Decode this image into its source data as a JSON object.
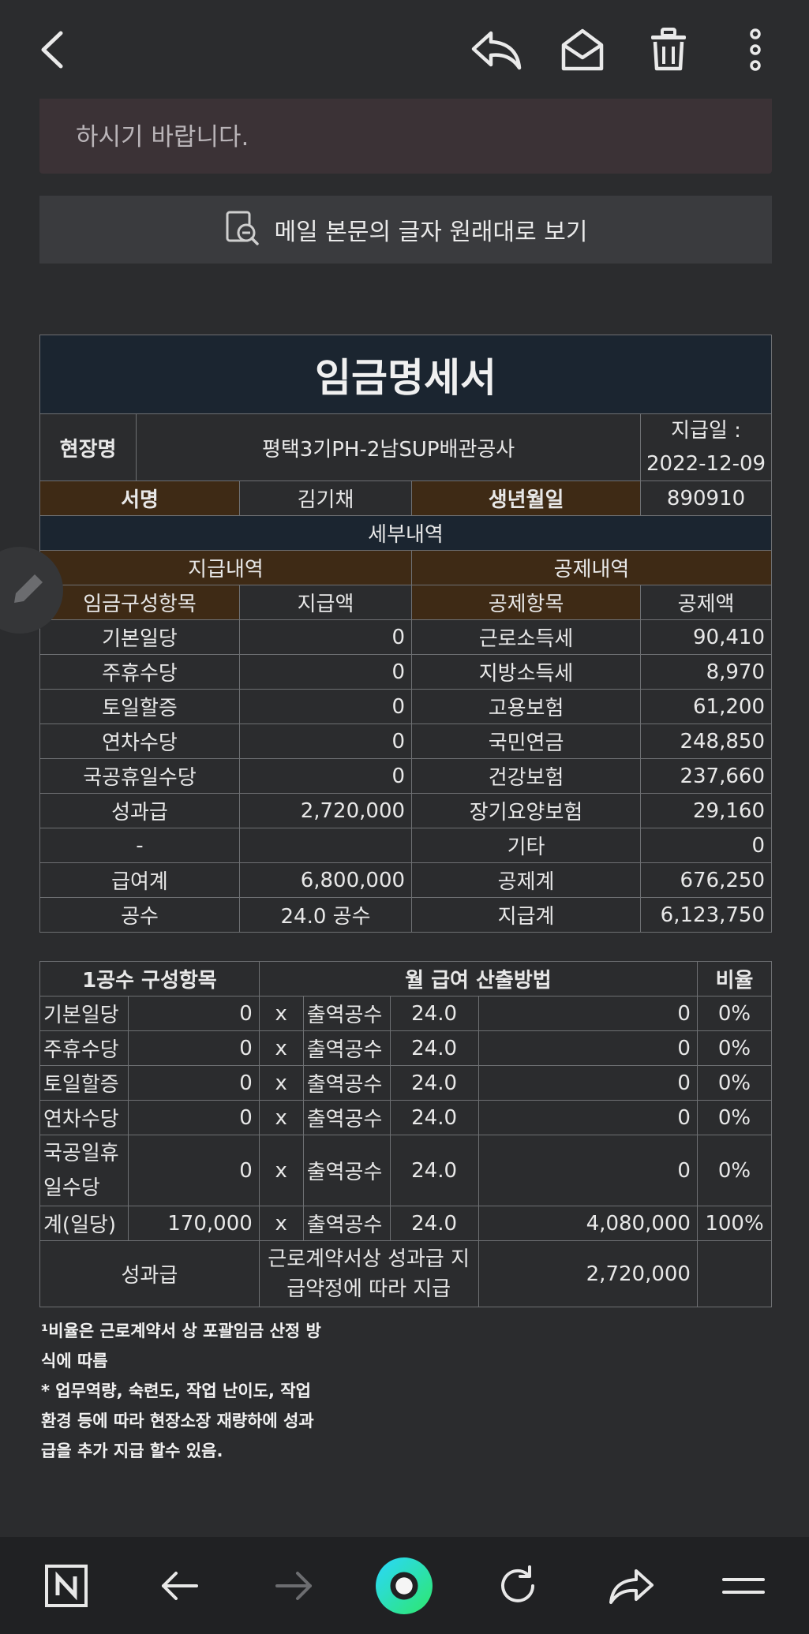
{
  "toolbar": {
    "back_icon": "back-arrow-icon",
    "reply_icon": "reply-icon",
    "unread_icon": "envelope-open-icon",
    "delete_icon": "trash-icon",
    "more_icon": "kebab-menu-icon"
  },
  "notice": {
    "text": "하시기 바랍니다."
  },
  "view_original": {
    "label": "메일 본문의 글자 원래대로 보기"
  },
  "payslip": {
    "title": "임금명세서",
    "site_label": "현장명",
    "site_value": "평택3기PH-2남SUP배관공사",
    "pay_date_label": "지급일 :",
    "pay_date_value": "2022-12-09",
    "name_label": "서명",
    "name_value": "김기채",
    "birth_label": "생년월일",
    "birth_value": "890910",
    "detail_header": "세부내역",
    "pay_section": "지급내역",
    "deduct_section": "공제내역",
    "col_pay_item": "임금구성항목",
    "col_pay_amount": "지급액",
    "col_deduct_item": "공제항목",
    "col_deduct_amount": "공제액",
    "rows": [
      {
        "pay_item": "기본일당",
        "pay_amount": "0",
        "deduct_item": "근로소득세",
        "deduct_amount": "90,410"
      },
      {
        "pay_item": "주휴수당",
        "pay_amount": "0",
        "deduct_item": "지방소득세",
        "deduct_amount": "8,970"
      },
      {
        "pay_item": "토일할증",
        "pay_amount": "0",
        "deduct_item": "고용보험",
        "deduct_amount": "61,200"
      },
      {
        "pay_item": "연차수당",
        "pay_amount": "0",
        "deduct_item": "국민연금",
        "deduct_amount": "248,850"
      },
      {
        "pay_item": "국공휴일수당",
        "pay_amount": "0",
        "deduct_item": "건강보험",
        "deduct_amount": "237,660"
      },
      {
        "pay_item": "성과급",
        "pay_amount": "2,720,000",
        "deduct_item": "장기요양보험",
        "deduct_amount": "29,160"
      },
      {
        "pay_item": "-",
        "pay_amount": "",
        "deduct_item": "기타",
        "deduct_amount": "0"
      },
      {
        "pay_item": "급여계",
        "pay_amount": "6,800,000",
        "deduct_item": "공제계",
        "deduct_amount": "676,250"
      },
      {
        "pay_item": "공수",
        "pay_amount": "24.0 공수",
        "deduct_item": "지급계",
        "deduct_amount": "6,123,750"
      }
    ]
  },
  "calc": {
    "h_items": "1공수 구성항목",
    "h_method": "월 급여 산출방법",
    "h_ratio": "비율",
    "rows": [
      {
        "item": "기본일당",
        "amount": "0",
        "x": "x",
        "label": "출역공수",
        "days": "24.0",
        "total": "0",
        "ratio": "0%"
      },
      {
        "item": "주휴수당",
        "amount": "0",
        "x": "x",
        "label": "출역공수",
        "days": "24.0",
        "total": "0",
        "ratio": "0%"
      },
      {
        "item": "토일할증",
        "amount": "0",
        "x": "x",
        "label": "출역공수",
        "days": "24.0",
        "total": "0",
        "ratio": "0%"
      },
      {
        "item": "연차수당",
        "amount": "0",
        "x": "x",
        "label": "출역공수",
        "days": "24.0",
        "total": "0",
        "ratio": "0%"
      },
      {
        "item": "국공일휴 일수당",
        "amount": "0",
        "x": "x",
        "label": "출역공수",
        "days": "24.0",
        "total": "0",
        "ratio": "0%"
      },
      {
        "item": "계(일당)",
        "amount": "170,000",
        "x": "x",
        "label": "출역공수",
        "days": "24.0",
        "total": "4,080,000",
        "ratio": "100%"
      }
    ],
    "bonus_label": "성과급",
    "bonus_method": "근로계약서상 성과급 지급약정에 따라 지급",
    "bonus_amount": "2,720,000"
  },
  "notes": {
    "line1": "¹비율은 근로계약서 상 포괄임금 산정 방식에 따름",
    "line2": "* 업무역량, 숙련도, 작업 난이도, 작업환경 등에 따라 현장소장 재량하에 성과급을 추가 지급 할수 있음."
  },
  "bottombar": {
    "home_icon": "n-logo-icon",
    "back_icon": "left-arrow-icon",
    "forward_icon": "right-arrow-icon",
    "center_icon": "green-ring-icon",
    "refresh_icon": "refresh-icon",
    "share_icon": "share-icon",
    "menu_icon": "menu-icon",
    "accent": "#1fd6a0"
  }
}
